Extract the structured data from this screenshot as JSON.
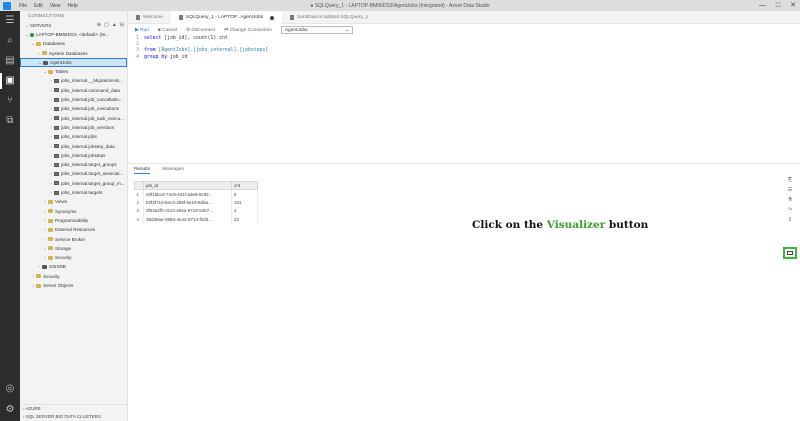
{
  "app": {
    "window_title": "● SQLQuery_1 - LAPTOP-BM66DS3\\AgentJobs (Integrated) - Azure Data Studio",
    "menu": [
      "File",
      "Edit",
      "View",
      "Help"
    ],
    "window_controls": [
      "—",
      "□",
      "✕"
    ]
  },
  "activity_bar": [
    {
      "name": "explorer-icon",
      "glyph": "☰"
    },
    {
      "name": "search-icon",
      "glyph": "⌕"
    },
    {
      "name": "notebooks-icon",
      "glyph": "▤"
    },
    {
      "name": "connections-icon",
      "glyph": "▣"
    },
    {
      "name": "source-control-icon",
      "glyph": "⑂"
    },
    {
      "name": "extensions-icon",
      "glyph": "⧉"
    },
    {
      "name": "account-icon",
      "glyph": "◎"
    },
    {
      "name": "settings-icon",
      "glyph": "⚙"
    }
  ],
  "sidebar": {
    "header": "CONNECTIONS",
    "servers_label": "SERVERS",
    "tree": [
      {
        "label": "LAPTOP-BM66DS3, <default> (W...",
        "indent": 0,
        "twistie": "⌄",
        "icon": "server"
      },
      {
        "label": "Databases",
        "indent": 1,
        "twistie": "⌄",
        "icon": "folder"
      },
      {
        "label": "System Databases",
        "indent": 2,
        "twistie": "›",
        "icon": "folder"
      },
      {
        "label": "AgentJobs",
        "indent": 2,
        "twistie": "⌄",
        "icon": "db",
        "selected": true
      },
      {
        "label": "Tables",
        "indent": 3,
        "twistie": "⌄",
        "icon": "folder"
      },
      {
        "label": "jobs_internal.__MigrationHis...",
        "indent": 4,
        "twistie": "›",
        "icon": "table"
      },
      {
        "label": "jobs_internal.command_data",
        "indent": 4,
        "twistie": "›",
        "icon": "table"
      },
      {
        "label": "jobs_internal.job_cancellatio...",
        "indent": 4,
        "twistie": "›",
        "icon": "table"
      },
      {
        "label": "jobs_internal.job_executions",
        "indent": 4,
        "twistie": "›",
        "icon": "table"
      },
      {
        "label": "jobs_internal.job_task_execu...",
        "indent": 4,
        "twistie": "›",
        "icon": "table"
      },
      {
        "label": "jobs_internal.job_versions",
        "indent": 4,
        "twistie": "›",
        "icon": "table"
      },
      {
        "label": "jobs_internal.jobs",
        "indent": 4,
        "twistie": "›",
        "icon": "table"
      },
      {
        "label": "jobs_internal.jobstep_data",
        "indent": 4,
        "twistie": "›",
        "icon": "table"
      },
      {
        "label": "jobs_internal.jobsteps",
        "indent": 4,
        "twistie": "›",
        "icon": "table"
      },
      {
        "label": "jobs_internal.target_groups",
        "indent": 4,
        "twistie": "›",
        "icon": "table"
      },
      {
        "label": "jobs_internal.target_associat...",
        "indent": 4,
        "twistie": "›",
        "icon": "table"
      },
      {
        "label": "jobs_internal.target_group_m...",
        "indent": 4,
        "twistie": "›",
        "icon": "table"
      },
      {
        "label": "jobs_internal.targets",
        "indent": 4,
        "twistie": "›",
        "icon": "table"
      },
      {
        "label": "Views",
        "indent": 3,
        "twistie": "›",
        "icon": "folder"
      },
      {
        "label": "Synonyms",
        "indent": 3,
        "twistie": "›",
        "icon": "folder"
      },
      {
        "label": "Programmability",
        "indent": 3,
        "twistie": "›",
        "icon": "folder"
      },
      {
        "label": "External Resources",
        "indent": 3,
        "twistie": "›",
        "icon": "folder"
      },
      {
        "label": "Service Broker",
        "indent": 3,
        "twistie": "›",
        "icon": "folder"
      },
      {
        "label": "Storage",
        "indent": 3,
        "twistie": "›",
        "icon": "folder"
      },
      {
        "label": "Security",
        "indent": 3,
        "twistie": "›",
        "icon": "folder"
      },
      {
        "label": "SSISDB",
        "indent": 2,
        "twistie": "›",
        "icon": "db"
      },
      {
        "label": "Security",
        "indent": 1,
        "twistie": "›",
        "icon": "folder"
      },
      {
        "label": "Server Objects",
        "indent": 1,
        "twistie": "›",
        "icon": "folder"
      }
    ],
    "bottom_sections": [
      "AZURE",
      "SQL SERVER BIG DATA CLUSTERS"
    ]
  },
  "tabs": [
    {
      "label": "Welcome",
      "active": false,
      "dirty": false
    },
    {
      "label": "SQLQuery_1 - LAPTOP...AgentJobs",
      "active": true,
      "dirty": true
    },
    {
      "label": "SandDance.sqlMod.SQLQuery_1",
      "active": false,
      "dirty": false
    }
  ],
  "toolbar": {
    "run": "▶ Run",
    "cancel": "■ Cancel",
    "disconnect": "⊘ Disconnect",
    "change_connection": "⇄ Change Connection",
    "database": "AgentJobs"
  },
  "code_lines": [
    {
      "n": "1",
      "parts": [
        [
          "kw",
          "select "
        ],
        [
          "",
          "[job_id], count(1) cnt"
        ]
      ]
    },
    {
      "n": "2",
      "parts": [
        [
          "",
          ""
        ]
      ]
    },
    {
      "n": "3",
      "parts": [
        [
          "kw",
          "from "
        ],
        [
          "obj",
          "[AgentJobs].[jobs_internal].[jobsteps]"
        ]
      ]
    },
    {
      "n": "4",
      "parts": [
        [
          "kw",
          "group by "
        ],
        [
          "",
          "job_id"
        ]
      ]
    }
  ],
  "results": {
    "tabs": [
      "Results",
      "Messages"
    ],
    "columns": [
      "job_id",
      "cnt"
    ],
    "rows": [
      {
        "rn": "1",
        "job_id": "e0f15bcd-74c9-401f-a3e9-9c92...",
        "cnt": "5"
      },
      {
        "rn": "2",
        "job_id": "b3f4f710-bec3-4b8f-be19-8d6a...",
        "cnt": "101"
      },
      {
        "rn": "3",
        "job_id": "0f03a4f0-c513-4e5a-9719-5457...",
        "cnt": "1"
      },
      {
        "rn": "4",
        "job_id": "35d39ae-3950-4e42-8714-f0d3...",
        "cnt": "22"
      }
    ]
  },
  "results_toolbar": [
    "⎘",
    "☴",
    "⚗",
    "↷",
    "↥"
  ],
  "caption": {
    "before": "Click on the ",
    "highlight": "Visualizer",
    "after": " button"
  },
  "colors": {
    "highlight": "#3a9a2a",
    "box": "#3cb63c",
    "selection": "#2d7dd2"
  }
}
